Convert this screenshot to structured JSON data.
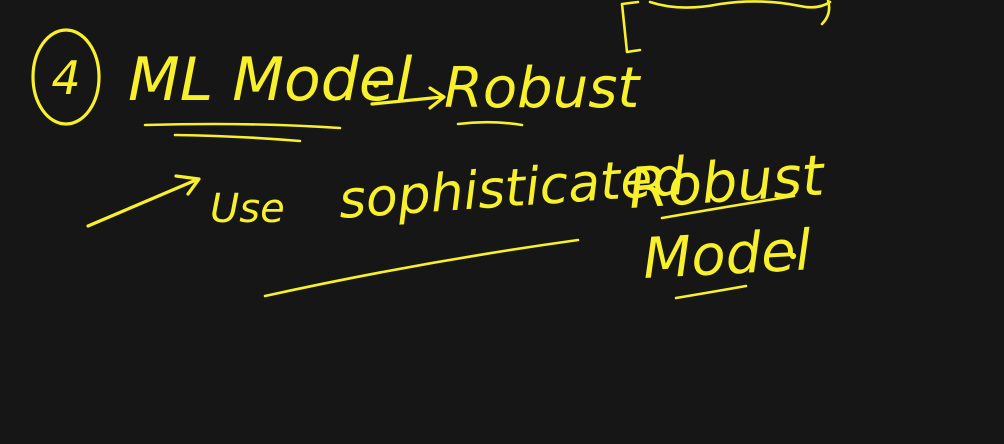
{
  "colors": {
    "background": "#161616",
    "ink": "#f7f02a"
  },
  "whiteboard": {
    "item_number": "4",
    "heading_term": "ML Model",
    "heading_result": "Robust",
    "bullet_verb": "Use",
    "bullet_adjective": "sophisticated",
    "bullet_term_line1": "Robust",
    "bullet_term_line2": "Model"
  }
}
